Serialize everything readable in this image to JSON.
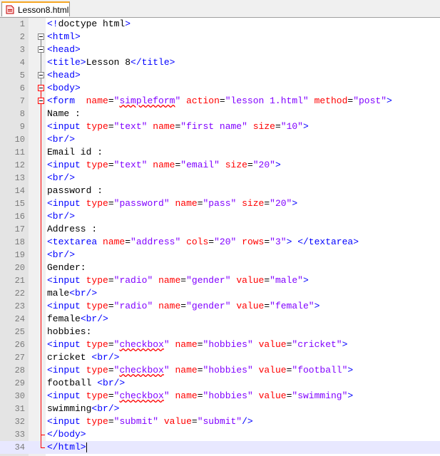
{
  "tab": {
    "label": "Lesson8.html"
  },
  "lines": [
    [
      [
        "tag",
        "<!"
      ],
      [
        "txt",
        "doctype html"
      ],
      [
        "tag",
        ">"
      ]
    ],
    [
      [
        "tag",
        "<html>"
      ]
    ],
    [
      [
        "tag",
        "<head>"
      ]
    ],
    [
      [
        "tag",
        "<title>"
      ],
      [
        "txt",
        "Lesson 8"
      ],
      [
        "tag",
        "</title>"
      ]
    ],
    [
      [
        "tag",
        "<head>"
      ]
    ],
    [
      [
        "tag",
        "<body>"
      ]
    ],
    [
      [
        "tag",
        "<form  "
      ],
      [
        "attr",
        "name"
      ],
      [
        "txt",
        "="
      ],
      [
        "val",
        "\"simpleform\""
      ],
      [
        "txt",
        " "
      ],
      [
        "attr",
        "action"
      ],
      [
        "txt",
        "="
      ],
      [
        "val",
        "\"lesson 1.html\""
      ],
      [
        "txt",
        " "
      ],
      [
        "attr",
        "method"
      ],
      [
        "txt",
        "="
      ],
      [
        "val",
        "\"post\""
      ],
      [
        "tag",
        ">"
      ]
    ],
    [
      [
        "txt",
        "Name :"
      ]
    ],
    [
      [
        "tag",
        "<input "
      ],
      [
        "attr",
        "type"
      ],
      [
        "txt",
        "="
      ],
      [
        "val",
        "\"text\""
      ],
      [
        "txt",
        " "
      ],
      [
        "attr",
        "name"
      ],
      [
        "txt",
        "="
      ],
      [
        "val",
        "\"first name\""
      ],
      [
        "txt",
        " "
      ],
      [
        "attr",
        "size"
      ],
      [
        "txt",
        "="
      ],
      [
        "val",
        "\"10\""
      ],
      [
        "tag",
        ">"
      ]
    ],
    [
      [
        "tag",
        "<br/>"
      ]
    ],
    [
      [
        "txt",
        "Email id :"
      ]
    ],
    [
      [
        "tag",
        "<input "
      ],
      [
        "attr",
        "type"
      ],
      [
        "txt",
        "="
      ],
      [
        "val",
        "\"text\""
      ],
      [
        "txt",
        " "
      ],
      [
        "attr",
        "name"
      ],
      [
        "txt",
        "="
      ],
      [
        "val",
        "\"email\""
      ],
      [
        "txt",
        " "
      ],
      [
        "attr",
        "size"
      ],
      [
        "txt",
        "="
      ],
      [
        "val",
        "\"20\""
      ],
      [
        "tag",
        ">"
      ]
    ],
    [
      [
        "tag",
        "<br/>"
      ]
    ],
    [
      [
        "txt",
        "password :"
      ]
    ],
    [
      [
        "tag",
        "<input "
      ],
      [
        "attr",
        "type"
      ],
      [
        "txt",
        "="
      ],
      [
        "val",
        "\"password\""
      ],
      [
        "txt",
        " "
      ],
      [
        "attr",
        "name"
      ],
      [
        "txt",
        "="
      ],
      [
        "val",
        "\"pass\""
      ],
      [
        "txt",
        " "
      ],
      [
        "attr",
        "size"
      ],
      [
        "txt",
        "="
      ],
      [
        "val",
        "\"20\""
      ],
      [
        "tag",
        ">"
      ]
    ],
    [
      [
        "tag",
        "<br/>"
      ]
    ],
    [
      [
        "txt",
        "Address :"
      ]
    ],
    [
      [
        "tag",
        "<textarea "
      ],
      [
        "attr",
        "name"
      ],
      [
        "txt",
        "="
      ],
      [
        "val",
        "\"address\""
      ],
      [
        "txt",
        " "
      ],
      [
        "attr",
        "cols"
      ],
      [
        "txt",
        "="
      ],
      [
        "val",
        "\"20\""
      ],
      [
        "txt",
        " "
      ],
      [
        "attr",
        "rows"
      ],
      [
        "txt",
        "="
      ],
      [
        "val",
        "\"3\""
      ],
      [
        "tag",
        ">"
      ],
      [
        "txt",
        " "
      ],
      [
        "tag",
        "</textarea>"
      ]
    ],
    [
      [
        "tag",
        "<br/>"
      ]
    ],
    [
      [
        "txt",
        "Gender:"
      ]
    ],
    [
      [
        "tag",
        "<input "
      ],
      [
        "attr",
        "type"
      ],
      [
        "txt",
        "="
      ],
      [
        "val",
        "\"radio\""
      ],
      [
        "txt",
        " "
      ],
      [
        "attr",
        "name"
      ],
      [
        "txt",
        "="
      ],
      [
        "val",
        "\"gender\""
      ],
      [
        "txt",
        " "
      ],
      [
        "attr",
        "value"
      ],
      [
        "txt",
        "="
      ],
      [
        "val",
        "\"male\""
      ],
      [
        "tag",
        ">"
      ]
    ],
    [
      [
        "txt",
        "male"
      ],
      [
        "tag",
        "<br/>"
      ]
    ],
    [
      [
        "tag",
        "<input "
      ],
      [
        "attr",
        "type"
      ],
      [
        "txt",
        "="
      ],
      [
        "val",
        "\"radio\""
      ],
      [
        "txt",
        " "
      ],
      [
        "attr",
        "name"
      ],
      [
        "txt",
        "="
      ],
      [
        "val",
        "\"gender\""
      ],
      [
        "txt",
        " "
      ],
      [
        "attr",
        "value"
      ],
      [
        "txt",
        "="
      ],
      [
        "val",
        "\"female\""
      ],
      [
        "tag",
        ">"
      ]
    ],
    [
      [
        "txt",
        "female"
      ],
      [
        "tag",
        "<br/>"
      ]
    ],
    [
      [
        "txt",
        "hobbies:"
      ]
    ],
    [
      [
        "tag",
        "<input "
      ],
      [
        "attr",
        "type"
      ],
      [
        "txt",
        "="
      ],
      [
        "val",
        "\"checkbox\""
      ],
      [
        "txt",
        " "
      ],
      [
        "attr",
        "name"
      ],
      [
        "txt",
        "="
      ],
      [
        "val",
        "\"hobbies\""
      ],
      [
        "txt",
        " "
      ],
      [
        "attr",
        "value"
      ],
      [
        "txt",
        "="
      ],
      [
        "val",
        "\"cricket\""
      ],
      [
        "tag",
        ">"
      ]
    ],
    [
      [
        "txt",
        "cricket "
      ],
      [
        "tag",
        "<br/>"
      ]
    ],
    [
      [
        "tag",
        "<input "
      ],
      [
        "attr",
        "type"
      ],
      [
        "txt",
        "="
      ],
      [
        "val",
        "\"checkbox\""
      ],
      [
        "txt",
        " "
      ],
      [
        "attr",
        "name"
      ],
      [
        "txt",
        "="
      ],
      [
        "val",
        "\"hobbies\""
      ],
      [
        "txt",
        " "
      ],
      [
        "attr",
        "value"
      ],
      [
        "txt",
        "="
      ],
      [
        "val",
        "\"football\""
      ],
      [
        "tag",
        ">"
      ]
    ],
    [
      [
        "txt",
        "football "
      ],
      [
        "tag",
        "<br/>"
      ]
    ],
    [
      [
        "tag",
        "<input "
      ],
      [
        "attr",
        "type"
      ],
      [
        "txt",
        "="
      ],
      [
        "val",
        "\"checkbox\""
      ],
      [
        "txt",
        " "
      ],
      [
        "attr",
        "name"
      ],
      [
        "txt",
        "="
      ],
      [
        "val",
        "\"hobbies\""
      ],
      [
        "txt",
        " "
      ],
      [
        "attr",
        "value"
      ],
      [
        "txt",
        "="
      ],
      [
        "val",
        "\"swimming\""
      ],
      [
        "tag",
        ">"
      ]
    ],
    [
      [
        "txt",
        "swimming"
      ],
      [
        "tag",
        "<br/>"
      ]
    ],
    [
      [
        "tag",
        "<input "
      ],
      [
        "attr",
        "type"
      ],
      [
        "txt",
        "="
      ],
      [
        "val",
        "\"submit\""
      ],
      [
        "txt",
        " "
      ],
      [
        "attr",
        "value"
      ],
      [
        "txt",
        "="
      ],
      [
        "val",
        "\"submit\""
      ],
      [
        "tag",
        "/>"
      ]
    ],
    [
      [
        "tag",
        "</body>"
      ]
    ],
    [
      [
        "tag",
        "</html>"
      ]
    ]
  ],
  "squiggle_words": [
    "simpleform",
    "checkbox"
  ],
  "current_line": 34,
  "colors": {
    "tag": "#0000ff",
    "attribute": "#ff0000",
    "value": "#8000ff",
    "text": "#000000",
    "tab_accent": "#f5a623"
  }
}
